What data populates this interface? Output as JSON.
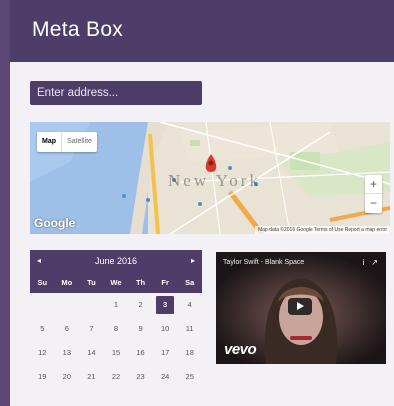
{
  "header": {
    "title": "Meta Box"
  },
  "address": {
    "placeholder": "Enter address..."
  },
  "map": {
    "type_on": "Map",
    "type_off": "Satellite",
    "city_label": "New York",
    "logo": "Google",
    "attribution": "Map data ©2016 Google   Terms of Use   Report a map error",
    "zoom_in": "+",
    "zoom_out": "−"
  },
  "calendar": {
    "month": "June 2016",
    "prev": "◂",
    "next": "▸",
    "weekdays": [
      "Su",
      "Mo",
      "Tu",
      "We",
      "Th",
      "Fr",
      "Sa"
    ],
    "days": [
      "",
      "",
      "",
      "1",
      "2",
      "3",
      "4",
      "5",
      "6",
      "7",
      "8",
      "9",
      "10",
      "11",
      "12",
      "13",
      "14",
      "15",
      "16",
      "17",
      "18",
      "19",
      "20",
      "21",
      "22",
      "23",
      "24",
      "25"
    ],
    "selected": "3"
  },
  "video": {
    "title": "Taylor Swift - Blank Space",
    "watermark": "vevo",
    "info_icon": "i",
    "share_icon": "↗"
  },
  "colors": {
    "brand": "#4e3d68",
    "panel": "#f3f1f6",
    "page": "#5a4775"
  }
}
